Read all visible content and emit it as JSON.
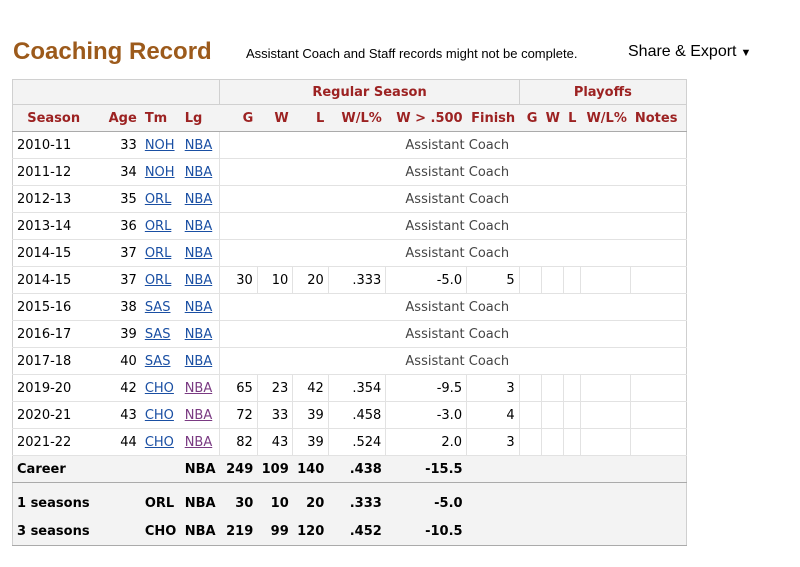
{
  "header": {
    "title": "Coaching Record",
    "note": "Assistant Coach and Staff records might not be complete.",
    "share_label": "Share & Export",
    "share_caret": "▼"
  },
  "table": {
    "group_headers": {
      "regular": "Regular Season",
      "playoffs": "Playoffs"
    },
    "columns": [
      "Season",
      "Age",
      "Tm",
      "Lg",
      "G",
      "W",
      "L",
      "W/L%",
      "W > .500",
      "Finish",
      "G",
      "W",
      "L",
      "W/L%",
      "Notes"
    ],
    "rows": [
      {
        "season": "2010-11",
        "age": "33",
        "tm": "NOH",
        "lg": "NBA",
        "assistant": "Assistant Coach"
      },
      {
        "season": "2011-12",
        "age": "34",
        "tm": "NOH",
        "lg": "NBA",
        "assistant": "Assistant Coach"
      },
      {
        "season": "2012-13",
        "age": "35",
        "tm": "ORL",
        "lg": "NBA",
        "assistant": "Assistant Coach"
      },
      {
        "season": "2013-14",
        "age": "36",
        "tm": "ORL",
        "lg": "NBA",
        "assistant": "Assistant Coach"
      },
      {
        "season": "2014-15",
        "age": "37",
        "tm": "ORL",
        "lg": "NBA",
        "assistant": "Assistant Coach"
      },
      {
        "season": "2014-15",
        "age": "37",
        "tm": "ORL",
        "lg": "NBA",
        "g": "30",
        "w": "10",
        "l": "20",
        "wl": "0.333",
        "wl_display": ".333",
        "w500": "-5.0",
        "finish": "5"
      },
      {
        "season": "2015-16",
        "age": "38",
        "tm": "SAS",
        "lg": "NBA",
        "assistant": "Assistant Coach"
      },
      {
        "season": "2016-17",
        "age": "39",
        "tm": "SAS",
        "lg": "NBA",
        "assistant": "Assistant Coach"
      },
      {
        "season": "2017-18",
        "age": "40",
        "tm": "SAS",
        "lg": "NBA",
        "assistant": "Assistant Coach"
      },
      {
        "season": "2019-20",
        "age": "42",
        "tm": "CHO",
        "lg": "NBA",
        "g": "65",
        "w": "23",
        "l": "42",
        "wl_display": ".354",
        "w500": "-9.5",
        "finish": "3"
      },
      {
        "season": "2020-21",
        "age": "43",
        "tm": "CHO",
        "lg": "NBA",
        "g": "72",
        "w": "33",
        "l": "39",
        "wl_display": ".458",
        "w500": "-3.0",
        "finish": "4"
      },
      {
        "season": "2021-22",
        "age": "44",
        "tm": "CHO",
        "lg": "NBA",
        "g": "82",
        "w": "43",
        "l": "39",
        "wl_display": ".524",
        "w500": "2.0",
        "finish": "3"
      }
    ],
    "career": {
      "label": "Career",
      "lg": "NBA",
      "g": "249",
      "w": "109",
      "l": "140",
      "wl": ".438",
      "w500": "-15.5"
    },
    "subtotals": [
      {
        "label": "1 seasons",
        "tm": "ORL",
        "lg": "NBA",
        "g": "30",
        "w": "10",
        "l": "20",
        "wl": ".333",
        "w500": "-5.0"
      },
      {
        "label": "3 seasons",
        "tm": "CHO",
        "lg": "NBA",
        "g": "219",
        "w": "99",
        "l": "120",
        "wl": ".452",
        "w500": "-10.5"
      }
    ],
    "colors": {
      "header_text": "#9c2222",
      "title": "#9c5a1b",
      "link": "#1a4fa3"
    }
  }
}
